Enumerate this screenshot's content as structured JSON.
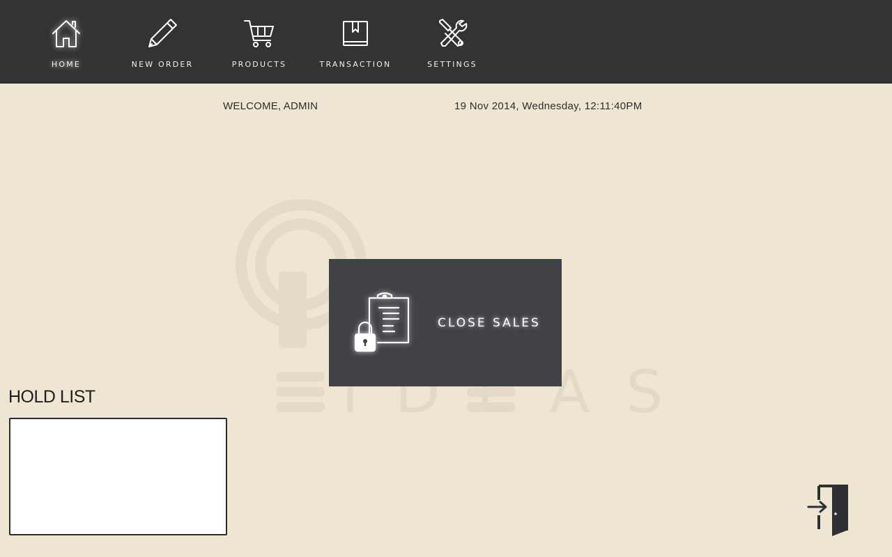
{
  "nav": {
    "items": [
      {
        "label": "HOME",
        "icon": "home-icon",
        "active": true
      },
      {
        "label": "NEW ORDER",
        "icon": "pen-icon",
        "active": false
      },
      {
        "label": "PRODUCTS",
        "icon": "cart-icon",
        "active": false
      },
      {
        "label": "TRANSACTION",
        "icon": "book-icon",
        "active": false
      },
      {
        "label": "SETTINGS",
        "icon": "tools-icon",
        "active": false
      }
    ]
  },
  "info": {
    "welcome": "WELCOME, ADMIN",
    "datetime": "19 Nov 2014, Wednesday, 12:11:40PM"
  },
  "watermark": {
    "text": "IDEAS"
  },
  "close_sales": {
    "label": "CLOSE SALES",
    "icon": "clipboard-lock-icon"
  },
  "hold_list": {
    "title": "HOLD LIST",
    "items": []
  },
  "logout": {
    "icon": "logout-door-icon"
  },
  "colors": {
    "background": "#efe5d3",
    "topbar": "#333333",
    "tile": "#414246",
    "text": "#2e2e2e"
  }
}
